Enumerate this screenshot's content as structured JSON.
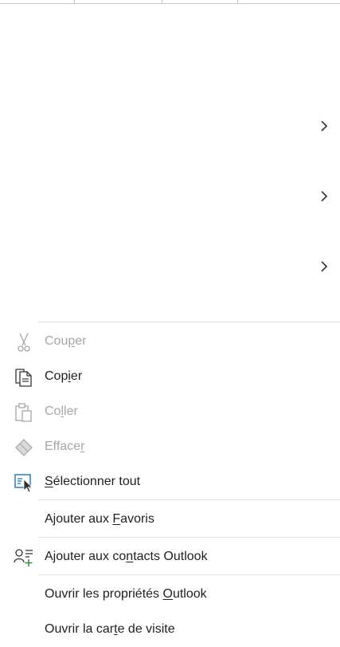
{
  "submenus": [
    {
      "label": "",
      "icon": "chevron-right-icon"
    },
    {
      "label": "",
      "icon": "chevron-right-icon"
    },
    {
      "label": "",
      "icon": "chevron-right-icon"
    }
  ],
  "menu": {
    "cut": {
      "pre": "Cou",
      "key": "p",
      "post": "er",
      "icon": "scissors-icon",
      "enabled": false
    },
    "copy": {
      "pre": "Cop",
      "key": "i",
      "post": "er",
      "icon": "copy-icon",
      "enabled": true
    },
    "paste": {
      "pre": "Co",
      "key": "l",
      "post": "ler",
      "icon": "clipboard-icon",
      "enabled": false
    },
    "clear": {
      "pre": "Efface",
      "key": "r",
      "post": "",
      "icon": "eraser-icon",
      "enabled": false
    },
    "select_all": {
      "pre": "",
      "key": "S",
      "post": "électionner tout",
      "icon": "select-all-icon",
      "enabled": true
    },
    "add_favorites": {
      "pre": "Ajouter aux ",
      "key": "F",
      "post": "avoris",
      "enabled": true
    },
    "add_contacts": {
      "pre": "Ajouter aux co",
      "key": "n",
      "post": "tacts Outlook",
      "icon": "add-contact-icon",
      "enabled": true
    },
    "open_properties": {
      "pre": "Ouvrir les propriétés ",
      "key": "O",
      "post": "utlook",
      "enabled": true
    },
    "open_card": {
      "pre": "Ouvrir la car",
      "key": "t",
      "post": "e de visite",
      "enabled": true
    }
  },
  "colors": {
    "text": "#1f1f1f",
    "disabled": "#a6a6a6",
    "accent": "#1e72b8",
    "green": "#2e9e3e"
  }
}
